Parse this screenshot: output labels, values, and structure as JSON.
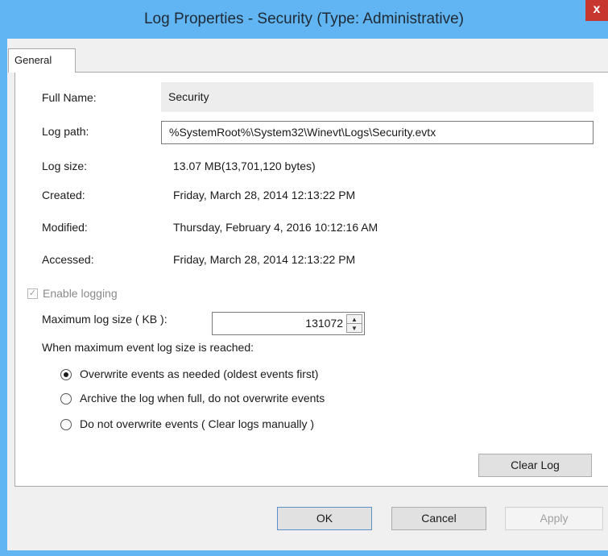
{
  "window": {
    "title": "Log Properties - Security (Type: Administrative)",
    "close_label": "x"
  },
  "tabs": [
    {
      "label": "General",
      "selected": true
    }
  ],
  "general": {
    "full_name_label": "Full Name:",
    "full_name_value": "Security",
    "log_path_label": "Log path:",
    "log_path_value": "%SystemRoot%\\System32\\Winevt\\Logs\\Security.evtx",
    "log_size_label": "Log size:",
    "log_size_value": "13.07 MB(13,701,120 bytes)",
    "created_label": "Created:",
    "created_value": "Friday, March 28, 2014 12:13:22 PM",
    "modified_label": "Modified:",
    "modified_value": "Thursday, February 4, 2016 10:12:16 AM",
    "accessed_label": "Accessed:",
    "accessed_value": "Friday, March 28, 2014 12:13:22 PM",
    "enable_logging_label": "Enable logging",
    "enable_logging_checked": true,
    "max_size_label": "Maximum log size ( KB ):",
    "max_size_value": "131072",
    "when_reached_label": "When maximum event log size is reached:",
    "options": [
      {
        "label": "Overwrite events as needed (oldest events first)",
        "checked": true
      },
      {
        "label": "Archive the log when full, do not overwrite events",
        "checked": false
      },
      {
        "label": "Do not overwrite events ( Clear logs manually )",
        "checked": false
      }
    ],
    "clear_log_label": "Clear Log"
  },
  "footer": {
    "ok_label": "OK",
    "cancel_label": "Cancel",
    "apply_label": "Apply"
  },
  "colors": {
    "titlebar": "#60b5f2",
    "close": "#c7372f",
    "panel_bg": "#f0f0f0"
  },
  "icons": {
    "close": "close-icon",
    "spin_up": "chevron-up-icon",
    "spin_down": "chevron-down-icon",
    "checkbox": "check-icon"
  }
}
